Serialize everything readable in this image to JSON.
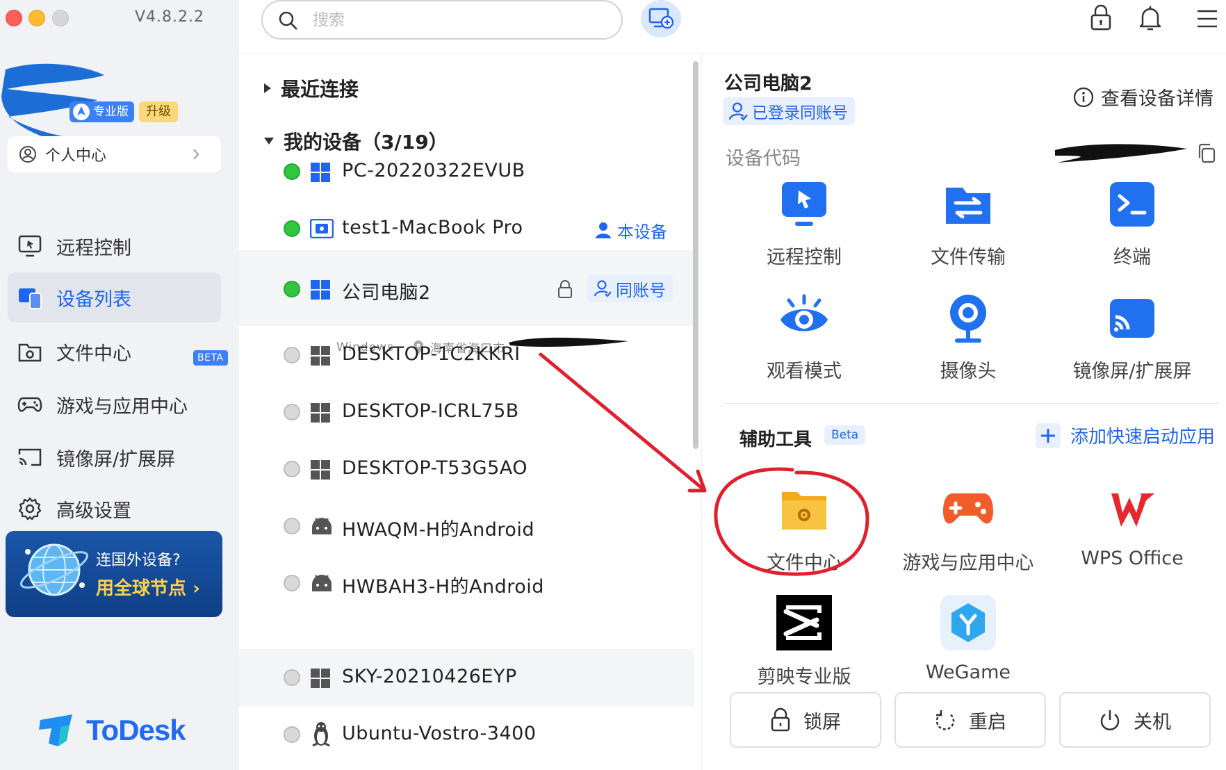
{
  "app": {
    "version": "V4.8.2.2",
    "logo_text": "ToDesk"
  },
  "account": {
    "badge_pro": "专业版",
    "badge_upgrade": "升级",
    "personal_center": "个人中心"
  },
  "sidebar": {
    "items": [
      {
        "label": "远程控制",
        "icon": "remote-control-icon"
      },
      {
        "label": "设备列表",
        "icon": "device-list-icon",
        "active": true
      },
      {
        "label": "文件中心",
        "icon": "file-center-icon"
      },
      {
        "label": "游戏与应用中心",
        "icon": "gamepad-icon",
        "badge": "BETA"
      },
      {
        "label": "镜像屏/扩展屏",
        "icon": "screen-cast-icon"
      },
      {
        "label": "高级设置",
        "icon": "gear-icon"
      }
    ],
    "promo": {
      "line1": "连国外设备?",
      "line2": "用全球节点"
    }
  },
  "search": {
    "placeholder": "搜索"
  },
  "devices": {
    "recent_label": "最近连接",
    "my_devices_label": "我的设备（3/19）",
    "list": [
      {
        "name": "PC-20220322EVUB",
        "os": "windows",
        "online": true
      },
      {
        "name": "test1-MacBook Pro",
        "os": "mac",
        "online": true,
        "tag": "本设备"
      },
      {
        "name": "公司电脑2",
        "os": "windows",
        "online": true,
        "tag": "同账号",
        "selected": true,
        "sub_os": "Windows",
        "sub_location": "海南省海口市"
      },
      {
        "name": "DESKTOP-1C2KKRI",
        "os": "windows",
        "online": false
      },
      {
        "name": "DESKTOP-ICRL75B",
        "os": "windows",
        "online": false
      },
      {
        "name": "DESKTOP-T53G5AO",
        "os": "windows",
        "online": false
      },
      {
        "name": "HWAQM-H的Android",
        "os": "android",
        "online": false
      },
      {
        "name": "HWBAH3-H的Android",
        "os": "android",
        "online": false
      },
      {
        "name": "SKY-20210426EYP",
        "os": "windows",
        "online": false
      },
      {
        "name": "Ubuntu-Vostro-3400",
        "os": "linux",
        "online": false
      }
    ]
  },
  "detail": {
    "title": "公司电脑2",
    "account_tag": "已登录同账号",
    "view_details": "查看设备详情",
    "code_label": "设备代码",
    "actions": [
      "远程控制",
      "文件传输",
      "终端",
      "观看模式",
      "摄像头",
      "镜像屏/扩展屏"
    ],
    "aux_title": "辅助工具",
    "aux_beta": "Beta",
    "aux_add": "添加快速启动应用",
    "aux_tools": [
      "文件中心",
      "游戏与应用中心",
      "WPS Office",
      "剪映专业版",
      "WeGame"
    ],
    "buttons": [
      "锁屏",
      "重启",
      "关机"
    ]
  },
  "colors": {
    "accent": "#2065ef",
    "online": "#2fc640",
    "annotation": "#e0202e"
  }
}
